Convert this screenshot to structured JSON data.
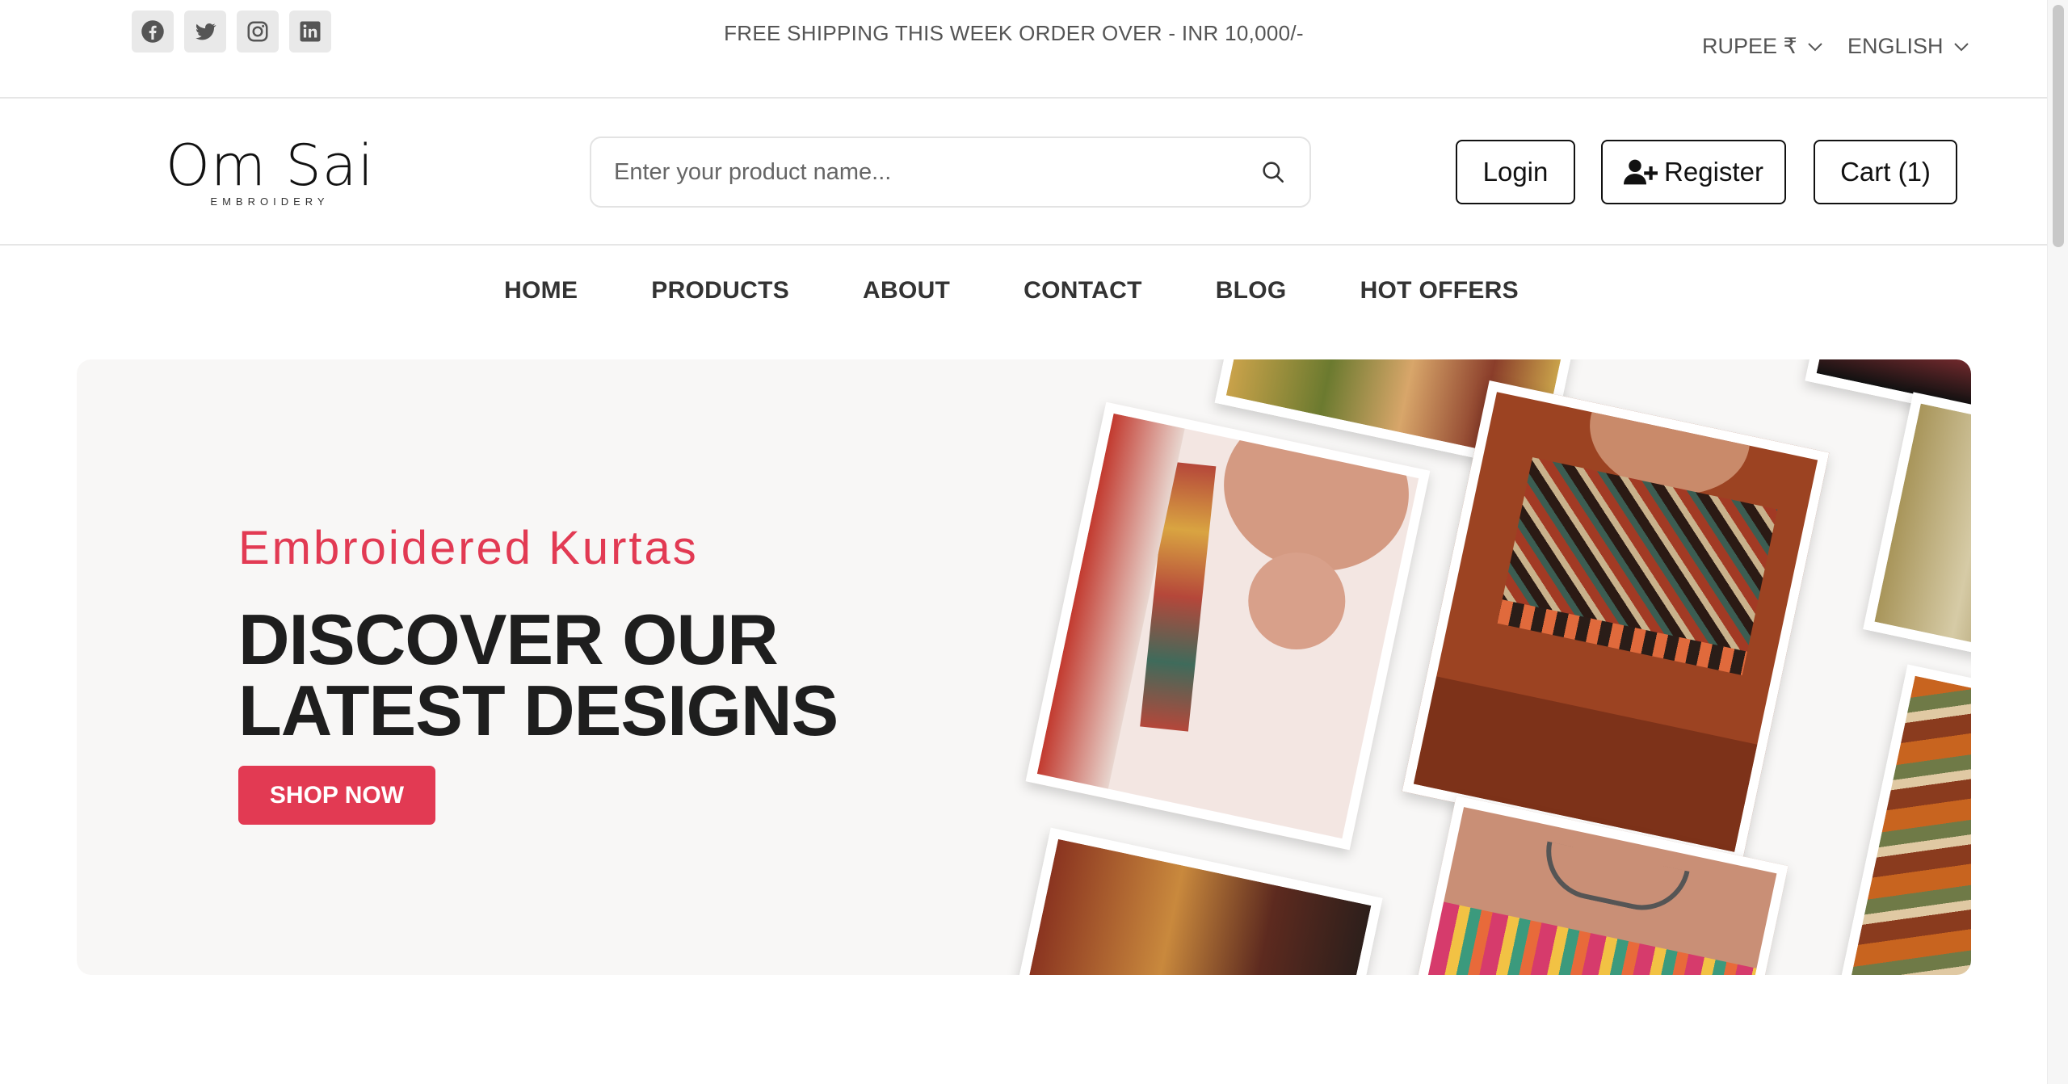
{
  "topbar": {
    "socials": [
      {
        "icon": "facebook-icon"
      },
      {
        "icon": "twitter-icon"
      },
      {
        "icon": "instagram-icon"
      },
      {
        "icon": "linkedin-icon"
      }
    ],
    "announcement": "FREE SHIPPING THIS WEEK ORDER OVER - INR 10,000/-",
    "currency": "RUPEE ₹",
    "language": "ENGLISH"
  },
  "header": {
    "logo_name": "Om Sai",
    "logo_sub": "EMBROIDERY",
    "search_placeholder": "Enter your product name...",
    "login_label": "Login",
    "register_label": "Register",
    "cart_label": "Cart (1)"
  },
  "nav": {
    "items": [
      "HOME",
      "PRODUCTS",
      "ABOUT",
      "CONTACT",
      "BLOG",
      "HOT OFFERS"
    ]
  },
  "hero": {
    "subtitle": "Embroidered Kurtas",
    "title_line1": "DISCOVER OUR",
    "title_line2": "LATEST DESIGNS",
    "cta_label": "SHOP NOW"
  },
  "colors": {
    "accent": "#e23a53",
    "hero_bg": "#f8f7f6",
    "text_dark": "#1e1e1e"
  }
}
